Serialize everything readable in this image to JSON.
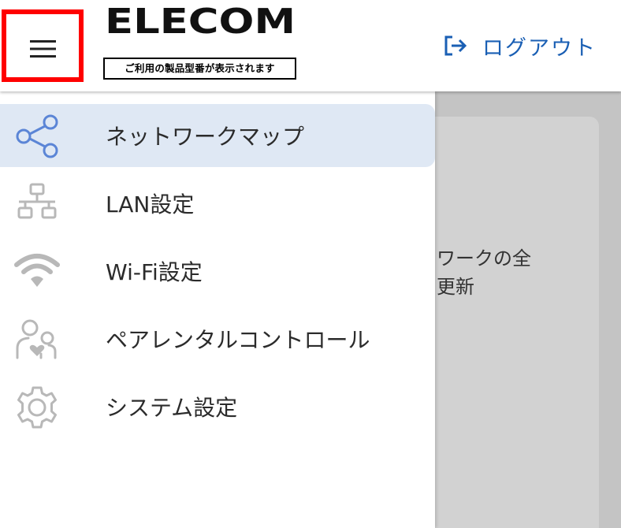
{
  "header": {
    "logo_text": "ELECOM",
    "model_note": "ご利用の製品型番が表示されます",
    "logout_label": "ログアウト"
  },
  "nav": {
    "items": [
      {
        "label": "ネットワークマップ",
        "icon": "share-network-icon",
        "active": true
      },
      {
        "label": "LAN設定",
        "icon": "lan-topology-icon",
        "active": false
      },
      {
        "label": "Wi-Fi設定",
        "icon": "wifi-icon",
        "active": false
      },
      {
        "label": "ペアレンタルコントロール",
        "icon": "parental-control-icon",
        "active": false
      },
      {
        "label": "システム設定",
        "icon": "gear-icon",
        "active": false
      }
    ]
  },
  "background": {
    "text_line_1": "ワークの全",
    "text_line_2": "更新"
  },
  "colors": {
    "accent": "#1a5fb4",
    "active_icon": "#5b85d6",
    "inactive_icon": "#b8b8b8",
    "active_bg": "#dfe8f4",
    "highlight_border": "#ff0000",
    "overlay": "#c4c4c4"
  }
}
